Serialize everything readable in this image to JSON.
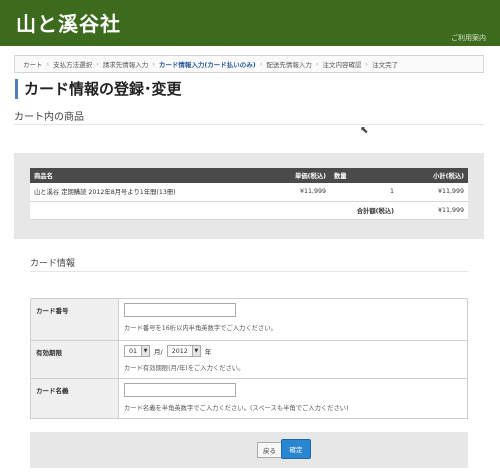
{
  "header": {
    "logo_text": "山と溪谷社",
    "user_link": "ご利用案内"
  },
  "breadcrumb": {
    "items": [
      {
        "label": "カート",
        "active": false
      },
      {
        "label": "支払方法選択",
        "active": false
      },
      {
        "label": "請求先情報入力",
        "active": false
      },
      {
        "label": "カード情報入力(カード払いのみ)",
        "active": true
      },
      {
        "label": "配送先情報入力",
        "active": false
      },
      {
        "label": "注文内容確認",
        "active": false
      },
      {
        "label": "注文完了",
        "active": false
      }
    ],
    "separator": "›"
  },
  "page_title": "カード情報の登録･変更",
  "cart": {
    "section_title": "カート内の商品",
    "columns": {
      "name": "商品名",
      "price": "単価(税込)",
      "qty": "数量",
      "subtotal": "小計(税込)"
    },
    "rows": [
      {
        "name": "山と溪谷 定期購読 2012年8月号より1年間(13冊)",
        "price": "¥11,999",
        "qty": "1",
        "subtotal": "¥11,999"
      }
    ],
    "total_label": "合計額(税込)",
    "total_value": "¥11,999"
  },
  "card_form": {
    "section_title": "カード情報",
    "card_number": {
      "label": "カード番号",
      "value": "",
      "hint": "カード番号を16桁以内半角英数字でご入力ください。"
    },
    "expiry": {
      "label": "有効期限",
      "month": "01",
      "month_unit": "月/",
      "year": "2012",
      "year_unit": "年",
      "hint": "カード有効期限(月/年)をご入力ください。"
    },
    "card_name": {
      "label": "カード名義",
      "value": "",
      "hint": "カード名義を半角英数字でご入力ください。(スペースも半角でご入力ください)"
    }
  },
  "buttons": {
    "back": "戻る",
    "confirm": "確定"
  },
  "icons": {
    "dropdown": "▼",
    "cursor": "⬉"
  },
  "colors": {
    "header_bg": "#3d6b1e",
    "accent": "#4d7fbf",
    "confirm_button": "#2a86cf"
  }
}
